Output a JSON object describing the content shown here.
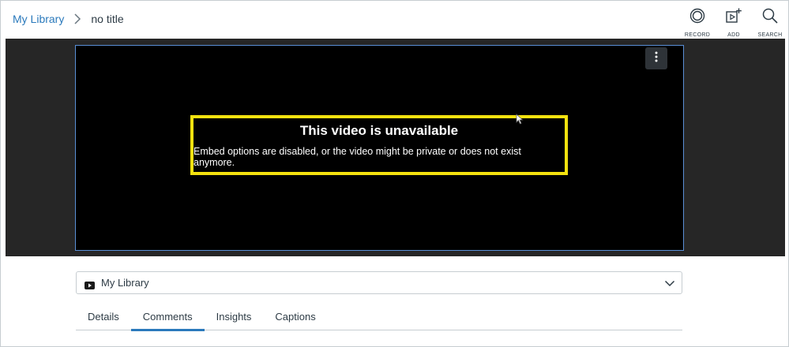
{
  "breadcrumb": {
    "root": "My Library",
    "current": "no title"
  },
  "toolbar": {
    "record_label": "RECORD",
    "add_label": "ADD",
    "search_label": "SEARCH"
  },
  "player": {
    "title": "This video is unavailable",
    "message": "Embed options are disabled, or the video might be private or does not exist anymore.",
    "menu_icon": "more-vertical-icon"
  },
  "source_selector": {
    "icon": "youtube-icon",
    "selected": "My Library"
  },
  "tabs": [
    {
      "label": "Details",
      "active": false
    },
    {
      "label": "Comments",
      "active": true
    },
    {
      "label": "Insights",
      "active": false
    },
    {
      "label": "Captions",
      "active": false
    }
  ],
  "colors": {
    "link": "#2b7abc",
    "highlight": "#f4e20f",
    "player_border": "#5a8fd6",
    "text": "#2d3b45"
  }
}
